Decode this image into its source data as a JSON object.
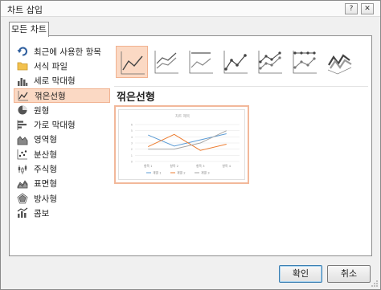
{
  "window": {
    "title": "차트 삽입",
    "help_glyph": "?",
    "close_glyph": "✕"
  },
  "tab": {
    "label": "모든 차트"
  },
  "categories": [
    {
      "label": "최근에 사용한 항목",
      "icon": "undo-arrow-icon"
    },
    {
      "label": "서식 파일",
      "icon": "folder-icon"
    },
    {
      "label": "세로 막대형",
      "icon": "column-chart-icon"
    },
    {
      "label": "꺾은선형",
      "icon": "line-chart-icon"
    },
    {
      "label": "원형",
      "icon": "pie-chart-icon"
    },
    {
      "label": "가로 막대형",
      "icon": "bar-chart-icon"
    },
    {
      "label": "영역형",
      "icon": "area-chart-icon"
    },
    {
      "label": "분산형",
      "icon": "scatter-chart-icon"
    },
    {
      "label": "주식형",
      "icon": "stock-chart-icon"
    },
    {
      "label": "표면형",
      "icon": "surface-chart-icon"
    },
    {
      "label": "방사형",
      "icon": "radar-chart-icon"
    },
    {
      "label": "콤보",
      "icon": "combo-chart-icon"
    }
  ],
  "selected_category": "꺾은선형",
  "subtypes": [
    {
      "icon": "line-subtype-icon",
      "selected": true
    },
    {
      "icon": "stacked-line-subtype-icon",
      "selected": false
    },
    {
      "icon": "percent-stacked-line-subtype-icon",
      "selected": false
    },
    {
      "icon": "line-markers-subtype-icon",
      "selected": false
    },
    {
      "icon": "stacked-line-markers-subtype-icon",
      "selected": false
    },
    {
      "icon": "percent-stacked-line-markers-subtype-icon",
      "selected": false
    },
    {
      "icon": "3d-line-subtype-icon",
      "selected": false
    }
  ],
  "heading": "꺾은선형",
  "chart_data": {
    "type": "line",
    "title": "차트 제목",
    "categories": [
      "항목 1",
      "항목 2",
      "항목 3",
      "항목 4"
    ],
    "series": [
      {
        "name": "계열 1",
        "values": [
          4.3,
          2.5,
          3.5,
          4.5
        ],
        "color": "#5b9bd5"
      },
      {
        "name": "계열 2",
        "values": [
          2.4,
          4.4,
          1.8,
          2.8
        ],
        "color": "#ed7d31"
      },
      {
        "name": "계열 3",
        "values": [
          2.0,
          2.0,
          3.0,
          5.0
        ],
        "color": "#a5a5a5"
      }
    ],
    "ylim": [
      0,
      6
    ],
    "grid": true,
    "legend": "bottom"
  },
  "buttons": {
    "ok": "확인",
    "cancel": "취소"
  },
  "colors": {
    "selection_fill": "#fbd9c4",
    "selection_border": "#f1b290",
    "accent": "#2b6cb0"
  }
}
